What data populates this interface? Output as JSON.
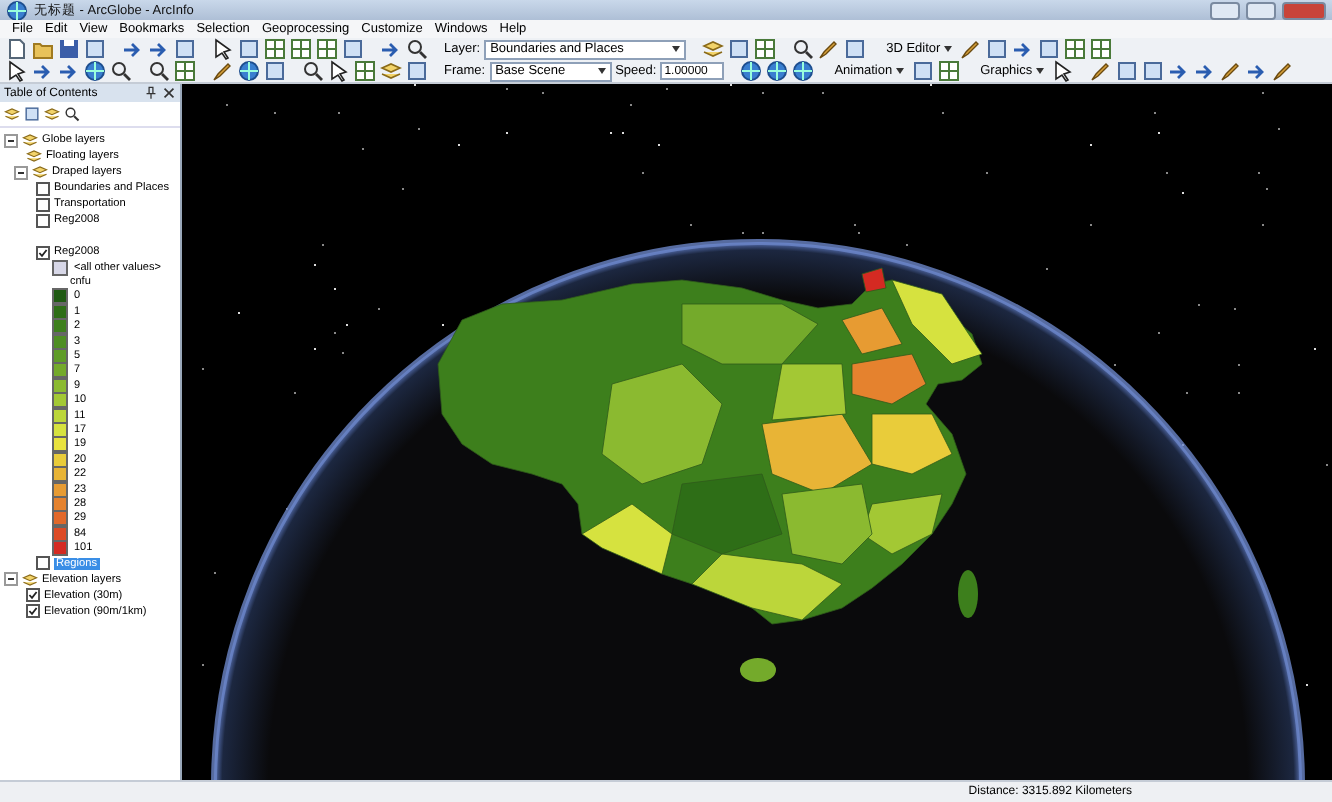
{
  "window": {
    "title": "无标题 - ArcGlobe - ArcInfo"
  },
  "menu": [
    "File",
    "Edit",
    "View",
    "Bookmarks",
    "Selection",
    "Geoprocessing",
    "Customize",
    "Windows",
    "Help"
  ],
  "toolbar": {
    "layer_label": "Layer:",
    "layer_value": "Boundaries and Places",
    "editor_menu": "3D Editor",
    "frame_label": "Frame:",
    "frame_value": "Base Scene",
    "speed_label": "Speed:",
    "speed_value": "1.00000",
    "animation_menu": "Animation",
    "graphics_menu": "Graphics"
  },
  "toc": {
    "title": "Table of Contents",
    "tree": [
      {
        "kind": "group",
        "label": "Globe layers",
        "expanded": true,
        "selected": false,
        "children": [
          {
            "kind": "group",
            "label": "Floating layers",
            "selected": false
          },
          {
            "kind": "group",
            "label": "Draped layers",
            "expanded": true,
            "selected": false,
            "children": [
              {
                "kind": "layer",
                "label": "Boundaries and Places",
                "checked": false,
                "selected": false
              },
              {
                "kind": "layer",
                "label": "Transportation",
                "checked": false,
                "selected": false
              },
              {
                "kind": "layer",
                "label": "Reg2008",
                "checked": false,
                "selected": false
              },
              {
                "kind": "layer",
                "label": "Reg2008",
                "checked": true,
                "selected": false,
                "legend": {
                  "heading": "<all other values>",
                  "field": "cnfu",
                  "classes": [
                    {
                      "label": "0",
                      "color": "#1f5a12"
                    },
                    {
                      "label": "1",
                      "color": "#2e6e17"
                    },
                    {
                      "label": "2",
                      "color": "#3d7f1c"
                    },
                    {
                      "label": "3",
                      "color": "#4e8e22"
                    },
                    {
                      "label": "5",
                      "color": "#5f9c27"
                    },
                    {
                      "label": "7",
                      "color": "#74aa2b"
                    },
                    {
                      "label": "9",
                      "color": "#8bba30"
                    },
                    {
                      "label": "10",
                      "color": "#a3c834"
                    },
                    {
                      "label": "11",
                      "color": "#bcd63a"
                    },
                    {
                      "label": "17",
                      "color": "#d6e23f"
                    },
                    {
                      "label": "19",
                      "color": "#e8e23e"
                    },
                    {
                      "label": "20",
                      "color": "#e9cc3a"
                    },
                    {
                      "label": "22",
                      "color": "#e8b436"
                    },
                    {
                      "label": "23",
                      "color": "#e79b32"
                    },
                    {
                      "label": "28",
                      "color": "#e5822e"
                    },
                    {
                      "label": "29",
                      "color": "#e2682a"
                    },
                    {
                      "label": "84",
                      "color": "#dd4a25"
                    },
                    {
                      "label": "101",
                      "color": "#d42a22"
                    }
                  ]
                }
              },
              {
                "kind": "layer",
                "label": "Regions",
                "checked": false,
                "selected": true
              }
            ]
          }
        ]
      },
      {
        "kind": "group",
        "label": "Elevation layers",
        "expanded": true,
        "selected": false,
        "children": [
          {
            "kind": "layer",
            "label": "Elevation (30m)",
            "checked": true,
            "selected": false
          },
          {
            "kind": "layer",
            "label": "Elevation (90m/1km)",
            "checked": true,
            "selected": false
          }
        ]
      }
    ]
  },
  "status_bar": {
    "distance": "Distance: 3315.892 Kilometers"
  }
}
